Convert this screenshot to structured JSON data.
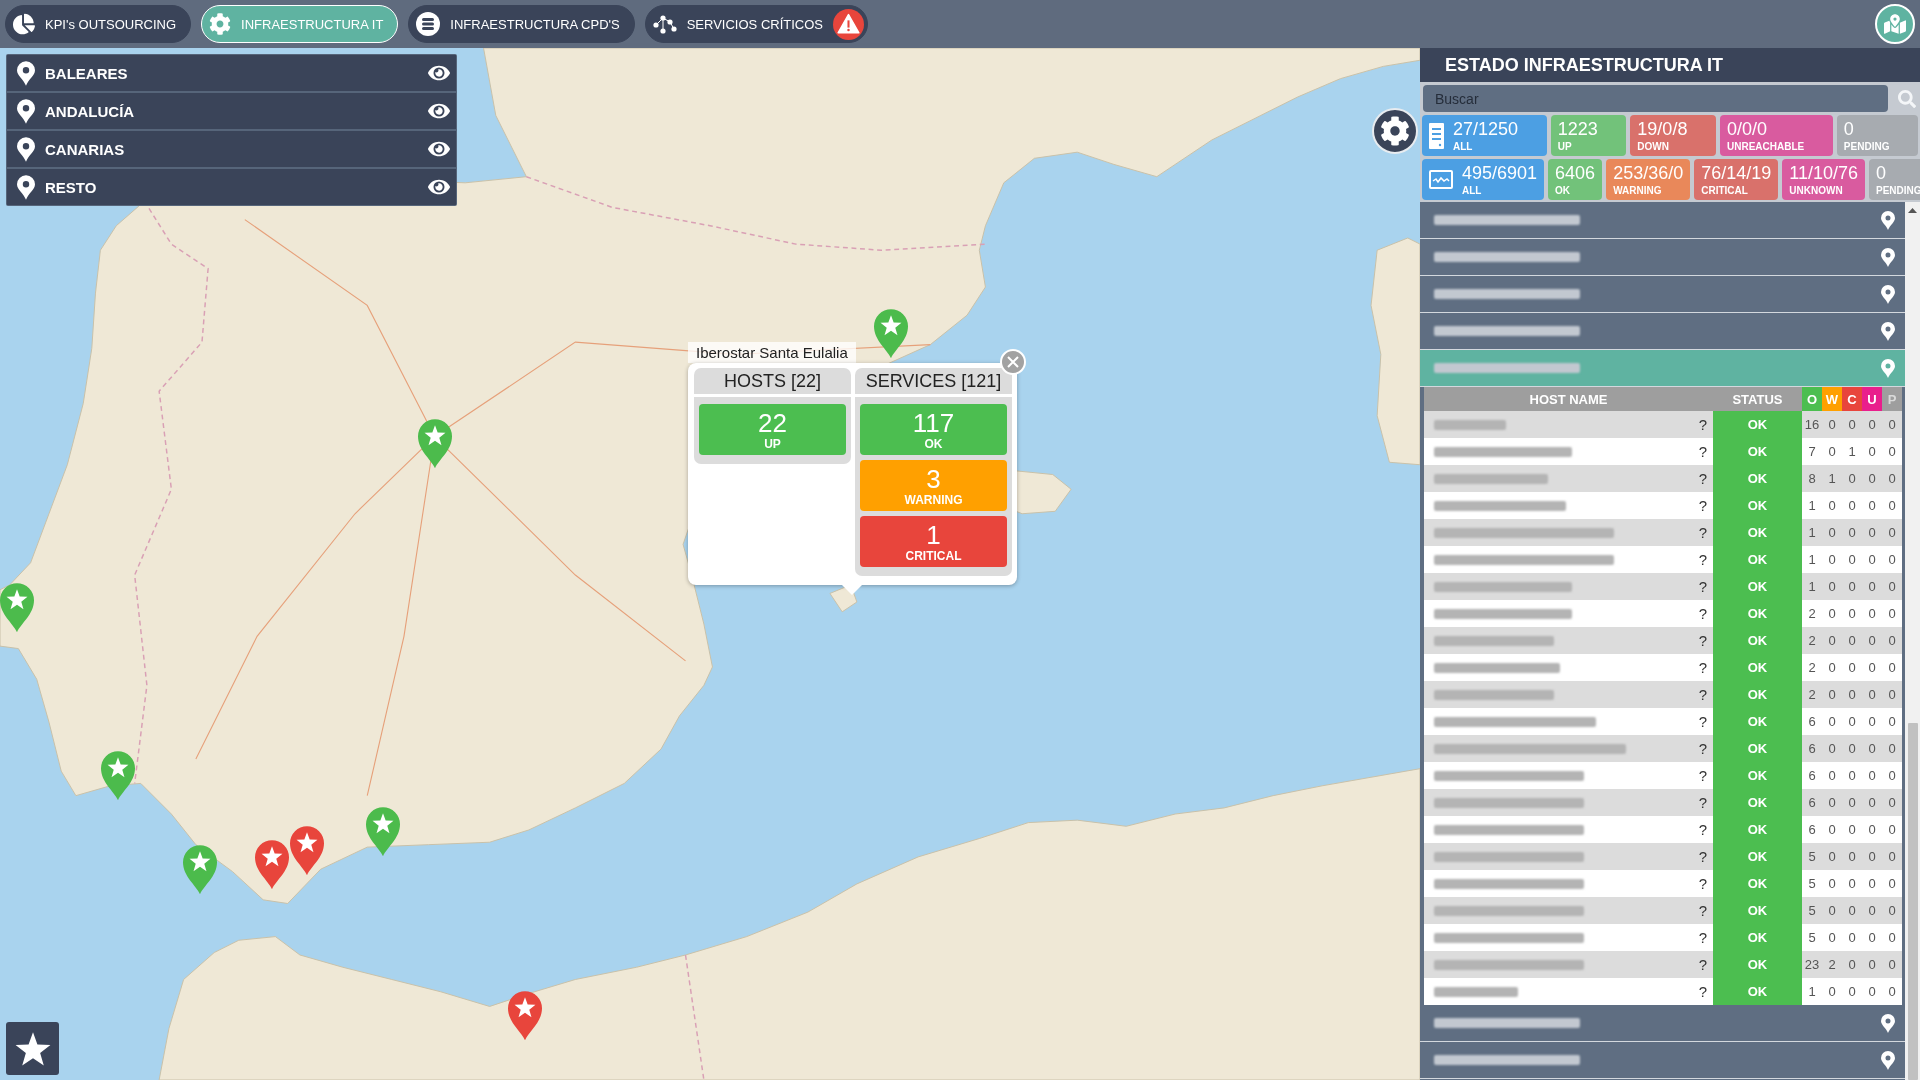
{
  "top_bar": {
    "tabs": [
      {
        "label": "KPI's OUTSOURCING",
        "selected": false,
        "alert": false
      },
      {
        "label": "INFRAESTRUCTURA IT",
        "selected": true,
        "alert": false
      },
      {
        "label": "INFRAESTRUCTURA CPD'S",
        "selected": false,
        "alert": false
      },
      {
        "label": "SERVICIOS CRÍTICOS",
        "selected": false,
        "alert": true
      }
    ]
  },
  "regions": [
    {
      "label": "BALEARES",
      "visible": true
    },
    {
      "label": "ANDALUCÍA",
      "visible": true
    },
    {
      "label": "CANARIAS",
      "visible": true
    },
    {
      "label": "RESTO",
      "visible": true
    }
  ],
  "map": {
    "markers": [
      {
        "color": "#4cbb4c"
      },
      {
        "color": "#4cbb4c"
      },
      {
        "color": "#4cbb4c"
      },
      {
        "color": "#4cbb4c"
      },
      {
        "color": "#4cbb4c"
      },
      {
        "color": "#e8453c"
      },
      {
        "color": "#e8453c"
      },
      {
        "color": "#4cbb4c"
      },
      {
        "color": "#e8453c"
      }
    ],
    "popup": {
      "title": "Iberostar Santa Eulalia",
      "columns": [
        {
          "header": "HOSTS [22]",
          "tiles": [
            {
              "value": "22",
              "label": "UP",
              "color": "#4cbe50"
            }
          ]
        },
        {
          "header": "SERVICES [121]",
          "tiles": [
            {
              "value": "117",
              "label": "OK",
              "color": "#4cbe50"
            },
            {
              "value": "3",
              "label": "WARNING",
              "color": "#ffa000"
            },
            {
              "value": "1",
              "label": "CRITICAL",
              "color": "#e8453c"
            }
          ]
        }
      ]
    }
  },
  "panel": {
    "title": "ESTADO INFRAESTRUCTURA IT",
    "search": {
      "placeholder": "Buscar"
    },
    "host_summary": [
      {
        "kind": "total",
        "value": "27/1250",
        "label": "ALL",
        "color": "#4c9fe3"
      },
      {
        "kind": "state",
        "value": "1223",
        "label": "UP",
        "color": "#72c27a"
      },
      {
        "kind": "state",
        "value": "19/0/8",
        "label": "DOWN",
        "color": "#d9716b"
      },
      {
        "kind": "state",
        "value": "0/0/0",
        "label": "UNREACHABLE",
        "color": "#d95b9f"
      },
      {
        "kind": "state",
        "value": "0",
        "label": "PENDING",
        "color": "#a7abb0"
      }
    ],
    "service_summary": [
      {
        "kind": "total",
        "value": "495/6901",
        "label": "ALL",
        "color": "#4c9fe3"
      },
      {
        "kind": "state",
        "value": "6406",
        "label": "OK",
        "color": "#72c27a"
      },
      {
        "kind": "state",
        "value": "253/36/0",
        "label": "WARNING",
        "color": "#e9885a"
      },
      {
        "kind": "state",
        "value": "76/14/19",
        "label": "CRITICAL",
        "color": "#d9716b"
      },
      {
        "kind": "state",
        "value": "11/10/76",
        "label": "UNKNOWN",
        "color": "#d95b9f"
      },
      {
        "kind": "state",
        "value": "0",
        "label": "PENDING",
        "color": "#a7abb0"
      }
    ],
    "groups": [
      {
        "expanded": false
      },
      {
        "expanded": false
      },
      {
        "expanded": false
      },
      {
        "expanded": false
      },
      {
        "expanded": true,
        "table": {
          "columns": [
            {
              "label": "HOST NAME"
            },
            {
              "label": "STATUS"
            },
            {
              "label": "O",
              "color": "#4cbe50"
            },
            {
              "label": "W",
              "color": "#ffa000"
            },
            {
              "label": "C",
              "color": "#e8453c"
            },
            {
              "label": "U",
              "color": "#e91e8c"
            },
            {
              "label": "P"
            }
          ],
          "rows": [
            {
              "info": "?",
              "status": {
                "label": "OK",
                "color": "#4cbe50"
              },
              "counts": [
                "16",
                "0",
                "0",
                "0",
                "0"
              ]
            },
            {
              "info": "?",
              "status": {
                "label": "OK",
                "color": "#4cbe50"
              },
              "counts": [
                "7",
                "0",
                "1",
                "0",
                "0"
              ]
            },
            {
              "info": "?",
              "status": {
                "label": "OK",
                "color": "#4cbe50"
              },
              "counts": [
                "8",
                "1",
                "0",
                "0",
                "0"
              ]
            },
            {
              "info": "?",
              "status": {
                "label": "OK",
                "color": "#4cbe50"
              },
              "counts": [
                "1",
                "0",
                "0",
                "0",
                "0"
              ]
            },
            {
              "info": "?",
              "status": {
                "label": "OK",
                "color": "#4cbe50"
              },
              "counts": [
                "1",
                "0",
                "0",
                "0",
                "0"
              ]
            },
            {
              "info": "?",
              "status": {
                "label": "OK",
                "color": "#4cbe50"
              },
              "counts": [
                "1",
                "0",
                "0",
                "0",
                "0"
              ]
            },
            {
              "info": "?",
              "status": {
                "label": "OK",
                "color": "#4cbe50"
              },
              "counts": [
                "1",
                "0",
                "0",
                "0",
                "0"
              ]
            },
            {
              "info": "?",
              "status": {
                "label": "OK",
                "color": "#4cbe50"
              },
              "counts": [
                "2",
                "0",
                "0",
                "0",
                "0"
              ]
            },
            {
              "info": "?",
              "status": {
                "label": "OK",
                "color": "#4cbe50"
              },
              "counts": [
                "2",
                "0",
                "0",
                "0",
                "0"
              ]
            },
            {
              "info": "?",
              "status": {
                "label": "OK",
                "color": "#4cbe50"
              },
              "counts": [
                "2",
                "0",
                "0",
                "0",
                "0"
              ]
            },
            {
              "info": "?",
              "status": {
                "label": "OK",
                "color": "#4cbe50"
              },
              "counts": [
                "2",
                "0",
                "0",
                "0",
                "0"
              ]
            },
            {
              "info": "?",
              "status": {
                "label": "OK",
                "color": "#4cbe50"
              },
              "counts": [
                "6",
                "0",
                "0",
                "0",
                "0"
              ]
            },
            {
              "info": "?",
              "status": {
                "label": "OK",
                "color": "#4cbe50"
              },
              "counts": [
                "6",
                "0",
                "0",
                "0",
                "0"
              ]
            },
            {
              "info": "?",
              "status": {
                "label": "OK",
                "color": "#4cbe50"
              },
              "counts": [
                "6",
                "0",
                "0",
                "0",
                "0"
              ]
            },
            {
              "info": "?",
              "status": {
                "label": "OK",
                "color": "#4cbe50"
              },
              "counts": [
                "6",
                "0",
                "0",
                "0",
                "0"
              ]
            },
            {
              "info": "?",
              "status": {
                "label": "OK",
                "color": "#4cbe50"
              },
              "counts": [
                "6",
                "0",
                "0",
                "0",
                "0"
              ]
            },
            {
              "info": "?",
              "status": {
                "label": "OK",
                "color": "#4cbe50"
              },
              "counts": [
                "5",
                "0",
                "0",
                "0",
                "0"
              ]
            },
            {
              "info": "?",
              "status": {
                "label": "OK",
                "color": "#4cbe50"
              },
              "counts": [
                "5",
                "0",
                "0",
                "0",
                "0"
              ]
            },
            {
              "info": "?",
              "status": {
                "label": "OK",
                "color": "#4cbe50"
              },
              "counts": [
                "5",
                "0",
                "0",
                "0",
                "0"
              ]
            },
            {
              "info": "?",
              "status": {
                "label": "OK",
                "color": "#4cbe50"
              },
              "counts": [
                "5",
                "0",
                "0",
                "0",
                "0"
              ]
            },
            {
              "info": "?",
              "status": {
                "label": "OK",
                "color": "#4cbe50"
              },
              "counts": [
                "23",
                "2",
                "0",
                "0",
                "0"
              ]
            },
            {
              "info": "?",
              "status": {
                "label": "OK",
                "color": "#4cbe50"
              },
              "counts": [
                "1",
                "0",
                "0",
                "0",
                "0"
              ]
            }
          ]
        }
      },
      {
        "expanded": false
      },
      {
        "expanded": false
      }
    ]
  }
}
